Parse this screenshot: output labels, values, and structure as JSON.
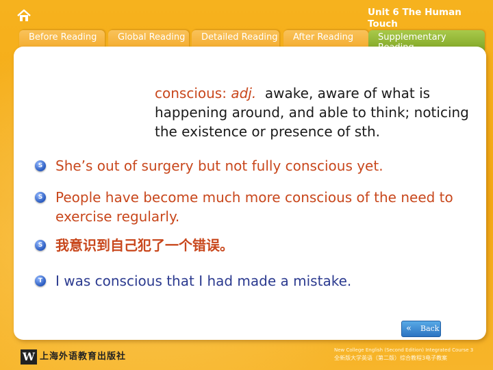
{
  "header": {
    "home_icon": "home-icon",
    "unit_title": "Unit 6 The Human Touch"
  },
  "tabs": [
    {
      "label": "Before Reading",
      "active": false
    },
    {
      "label": "Global Reading",
      "active": false
    },
    {
      "label": "Detailed Reading",
      "active": false
    },
    {
      "label": "After Reading",
      "active": false
    },
    {
      "label": "Supplementary Reading",
      "active": true
    }
  ],
  "definition": {
    "word": "conscious:",
    "pos": "adj.",
    "meaning": "awake, aware of what is happening around, and able to think; noticing the existence or presence of sth."
  },
  "examples": [
    {
      "bullet": "S",
      "text": "She’s out of surgery but not fully conscious yet."
    },
    {
      "bullet": "S",
      "text": "People have become much more conscious of the need to exercise regularly."
    },
    {
      "bullet": "S",
      "text": "我意识到自己犯了一个错误。"
    },
    {
      "bullet": "T",
      "text": " I was conscious that I had made a mistake."
    }
  ],
  "nav": {
    "back_label": "Back",
    "back_icon": "double-chevron-left-icon"
  },
  "logo": {
    "mark": "W",
    "text": "上海外语教育出版社"
  },
  "footer": {
    "line1": "New College English (Second Edition) Integrated Course 3",
    "line2": "全新版大学英语（第二版）综合教程3电子教案"
  },
  "colors": {
    "background": "#f4a814",
    "active_tab": "#8cb232",
    "accent_red": "#c8471c",
    "translation_blue": "#2b3a8f"
  }
}
